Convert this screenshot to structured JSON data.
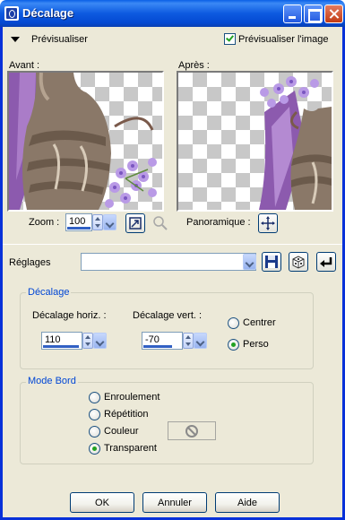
{
  "window": {
    "title": "Décalage"
  },
  "preview_header": {
    "toggle_label": "Prévisualiser",
    "preview_image_label": "Prévisualiser l'image",
    "preview_image_checked": true
  },
  "previews": {
    "before_label": "Avant :",
    "after_label": "Après :"
  },
  "zoom": {
    "label": "Zoom :",
    "value": "100"
  },
  "pan": {
    "label": "Panoramique :"
  },
  "settings": {
    "label": "Réglages",
    "value": ""
  },
  "offset_group": {
    "title": "Décalage",
    "horiz_label": "Décalage horiz. :",
    "horiz_value": "110",
    "vert_label": "Décalage vert. :",
    "vert_value": "-70",
    "options": [
      {
        "label": "Centrer",
        "selected": false
      },
      {
        "label": "Perso",
        "selected": true
      }
    ]
  },
  "edge_group": {
    "title": "Mode Bord",
    "options": [
      {
        "label": "Enroulement",
        "selected": false
      },
      {
        "label": "Répétition",
        "selected": false
      },
      {
        "label": "Couleur",
        "selected": false
      },
      {
        "label": "Transparent",
        "selected": true
      }
    ]
  },
  "footer": {
    "ok": "OK",
    "cancel": "Annuler",
    "help": "Aide"
  },
  "colors": {
    "titlebar": "#0a5fe6",
    "dialog_bg": "#ece9d8",
    "group_title": "#0046d5",
    "check_green": "#21a121"
  }
}
